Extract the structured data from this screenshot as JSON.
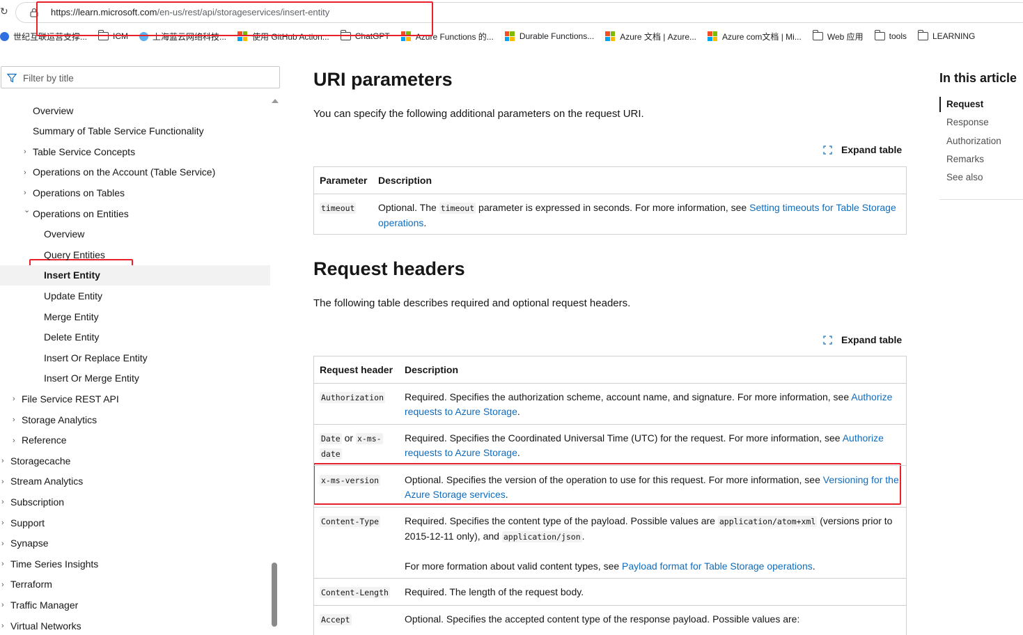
{
  "browser": {
    "url_host": "https://learn.microsoft.com",
    "url_path": "/en-us/rest/api/storageservices/insert-entity"
  },
  "bookmarks": [
    {
      "label": "世纪互联运营支撑...",
      "icon": "globe-icon"
    },
    {
      "label": "ICM",
      "icon": "folder-icon"
    },
    {
      "label": "上海蓝云网络科技...",
      "icon": "edge-icon"
    },
    {
      "label": "使用 GitHub Action...",
      "icon": "microsoft-logo-icon"
    },
    {
      "label": "ChatGPT",
      "icon": "folder-icon"
    },
    {
      "label": "Azure Functions 的...",
      "icon": "microsoft-logo-icon"
    },
    {
      "label": "Durable Functions...",
      "icon": "microsoft-logo-icon"
    },
    {
      "label": "Azure 文档 | Azure...",
      "icon": "microsoft-logo-icon"
    },
    {
      "label": "Azure com文档 | Mi...",
      "icon": "microsoft-logo-icon"
    },
    {
      "label": "Web 应用",
      "icon": "folder-icon"
    },
    {
      "label": "tools",
      "icon": "folder-icon"
    },
    {
      "label": "LEARNING",
      "icon": "folder-icon"
    }
  ],
  "filter": {
    "placeholder": "Filter by title"
  },
  "nav": [
    {
      "label": "Overview",
      "level": 2,
      "chevron": "",
      "active": false
    },
    {
      "label": "Summary of Table Service Functionality",
      "level": 2,
      "chevron": "",
      "active": false
    },
    {
      "label": "Table Service Concepts",
      "level": 2,
      "chevron": "right",
      "active": false
    },
    {
      "label": "Operations on the Account (Table Service)",
      "level": 2,
      "chevron": "right",
      "active": false
    },
    {
      "label": "Operations on Tables",
      "level": 2,
      "chevron": "right",
      "active": false
    },
    {
      "label": "Operations on Entities",
      "level": 2,
      "chevron": "down",
      "active": false
    },
    {
      "label": "Overview",
      "level": 3,
      "chevron": "",
      "active": false
    },
    {
      "label": "Query Entities",
      "level": 3,
      "chevron": "",
      "active": false
    },
    {
      "label": "Insert Entity",
      "level": 3,
      "chevron": "",
      "active": true
    },
    {
      "label": "Update Entity",
      "level": 3,
      "chevron": "",
      "active": false
    },
    {
      "label": "Merge Entity",
      "level": 3,
      "chevron": "",
      "active": false
    },
    {
      "label": "Delete Entity",
      "level": 3,
      "chevron": "",
      "active": false
    },
    {
      "label": "Insert Or Replace Entity",
      "level": 3,
      "chevron": "",
      "active": false
    },
    {
      "label": "Insert Or Merge Entity",
      "level": 3,
      "chevron": "",
      "active": false
    },
    {
      "label": "File Service REST API",
      "level": 1,
      "chevron": "right",
      "active": false
    },
    {
      "label": "Storage Analytics",
      "level": 1,
      "chevron": "right",
      "active": false
    },
    {
      "label": "Reference",
      "level": 1,
      "chevron": "right",
      "active": false
    },
    {
      "label": "Storagecache",
      "level": 0,
      "chevron": "right",
      "active": false
    },
    {
      "label": "Stream Analytics",
      "level": 0,
      "chevron": "right",
      "active": false
    },
    {
      "label": "Subscription",
      "level": 0,
      "chevron": "right",
      "active": false
    },
    {
      "label": "Support",
      "level": 0,
      "chevron": "right",
      "active": false
    },
    {
      "label": "Synapse",
      "level": 0,
      "chevron": "right",
      "active": false
    },
    {
      "label": "Time Series Insights",
      "level": 0,
      "chevron": "right",
      "active": false
    },
    {
      "label": "Terraform",
      "level": 0,
      "chevron": "right",
      "active": false
    },
    {
      "label": "Traffic Manager",
      "level": 0,
      "chevron": "right",
      "active": false
    },
    {
      "label": "Virtual Networks",
      "level": 0,
      "chevron": "right",
      "active": false
    }
  ],
  "main": {
    "uri_heading": "URI parameters",
    "uri_text": "You can specify the following additional parameters on the request URI.",
    "expand_label": "Expand table",
    "uri_table": {
      "col1": "Parameter",
      "col2": "Description",
      "r1_param": "timeout",
      "r1_a": "Optional. The ",
      "r1_code": "timeout",
      "r1_b": " parameter is expressed in seconds. For more information, see ",
      "r1_link1": "Setting timeouts for Table Storage",
      "r1_link2": "operations",
      "r1_end": "."
    },
    "req_heading": "Request headers",
    "req_text": "The following table describes required and optional request headers.",
    "req_table": {
      "col1": "Request header",
      "col2": "Description",
      "auth_name": "Authorization",
      "auth_text": "Required. Specifies the authorization scheme, account name, and signature. For more information, see ",
      "auth_link1": "Authorize",
      "auth_link2": "requests to Azure Storage",
      "date_name1": "Date",
      "date_or": "or",
      "date_name2": "x-ms-",
      "date_name3": "date",
      "date_text": "Required. Specifies the Coordinated Universal Time (UTC) for the request. For more information, see ",
      "date_link1": "Authorize",
      "date_link2": "requests to Azure Storage",
      "ver_name": "x-ms-version",
      "ver_text": "Optional. Specifies the version of the operation to use for this request. For more information, see ",
      "ver_link1": "Versioning for the",
      "ver_link2": "Azure Storage services",
      "ct_name": "Content-Type",
      "ct_text1": "Required. Specifies the content type of the payload. Possible values are ",
      "ct_code1": "application/atom+xml",
      "ct_text2": " (versions prior to",
      "ct_text3": "2015-12-11 only), and ",
      "ct_code2": "application/json",
      "ct_text4": "For more formation about valid content types, see ",
      "ct_link": "Payload format for Table Storage operations",
      "cl_name": "Content-Length",
      "cl_text": "Required. The length of the request body.",
      "acc_name": "Accept",
      "acc_text": "Optional. Specifies the accepted content type of the response payload. Possible values are:",
      "period": "."
    }
  },
  "toc": {
    "title": "In this article",
    "items": [
      "Request",
      "Response",
      "Authorization",
      "Remarks",
      "See also"
    ]
  },
  "colors": {
    "accent": "#0f6cbd",
    "highlight": "#e8202a"
  }
}
